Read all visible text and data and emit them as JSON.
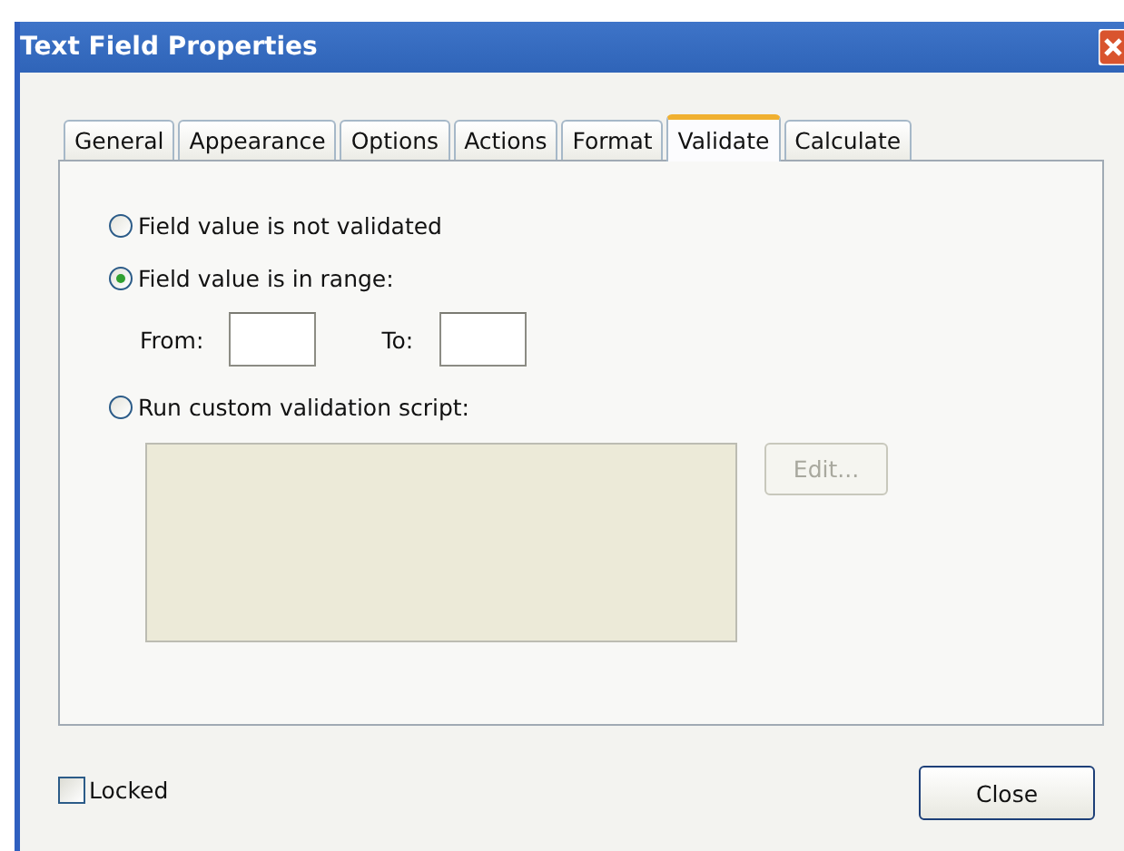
{
  "window": {
    "title": "Text Field Properties"
  },
  "tabs": [
    {
      "label": "General",
      "selected": false
    },
    {
      "label": "Appearance",
      "selected": false
    },
    {
      "label": "Options",
      "selected": false
    },
    {
      "label": "Actions",
      "selected": false
    },
    {
      "label": "Format",
      "selected": false
    },
    {
      "label": "Validate",
      "selected": true
    },
    {
      "label": "Calculate",
      "selected": false
    }
  ],
  "validation_options": [
    {
      "label": "Field value is not validated",
      "selected": false
    },
    {
      "label": "Field value is in range:",
      "selected": true
    },
    {
      "label": "Run custom validation script:",
      "selected": false
    }
  ],
  "range": {
    "from_label": "From:",
    "to_label": "To:"
  },
  "script": {
    "edit_button": "Edit...",
    "disabled": true
  },
  "locked": {
    "label": "Locked",
    "checked": false
  },
  "close_button": "Close"
}
